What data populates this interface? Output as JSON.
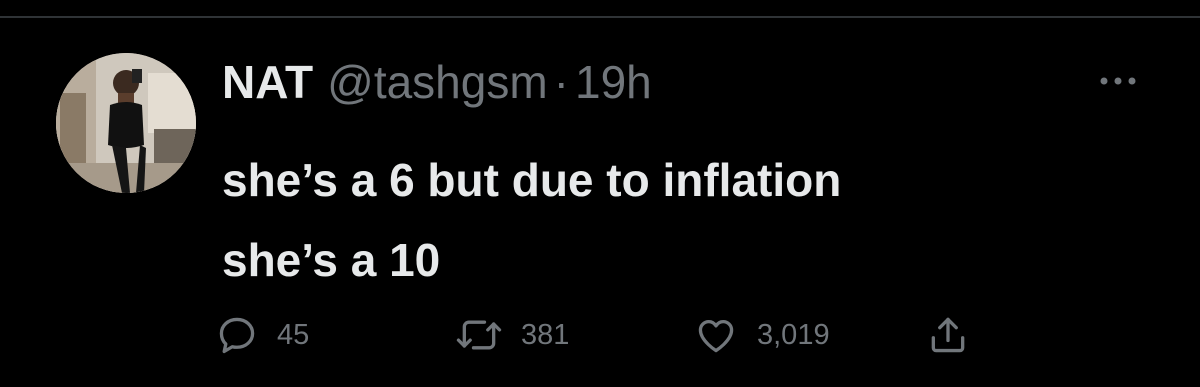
{
  "tweet": {
    "author_name": "NAT",
    "handle": "@tashgsm",
    "separator": "·",
    "time": "19h",
    "text_lines": [
      "she’s a 6 but due to inflation",
      "she’s a 10"
    ]
  },
  "actions": {
    "reply_count": "45",
    "retweet_count": "381",
    "like_count": "3,019"
  },
  "icons": {
    "reply": "reply-bubble-icon",
    "retweet": "retweet-arrows-icon",
    "like": "heart-icon",
    "share": "share-upload-icon",
    "more": "more-dots-icon"
  },
  "colors": {
    "background": "#000000",
    "primary_text": "#e7e9ea",
    "secondary_text": "#71767b",
    "divider": "#2f3336"
  }
}
